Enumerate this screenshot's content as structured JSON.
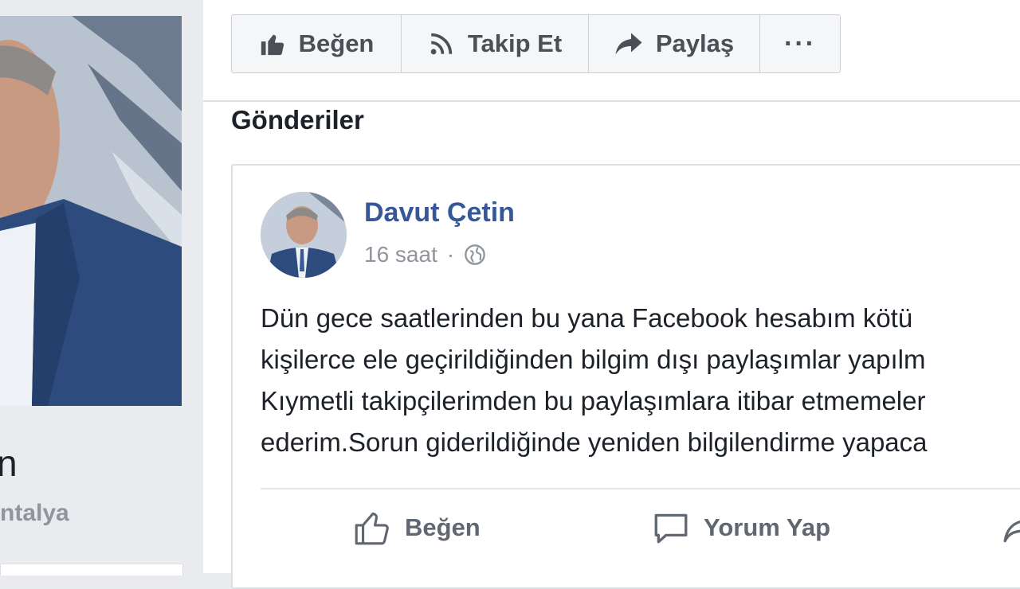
{
  "profile": {
    "name_fragment": "n",
    "location_fragment": "ntalya"
  },
  "action_bar": {
    "like_label": "Beğen",
    "follow_label": "Takip Et",
    "share_label": "Paylaş",
    "more_label": "···"
  },
  "posts_heading": "Gönderiler",
  "post": {
    "author": "Davut Çetin",
    "time": "16 saat",
    "separator": "·",
    "text_lines": [
      "Dün gece saatlerinden bu yana Facebook hesabım kötü",
      "kişilerce ele geçirildiğinden bilgim dışı paylaşımlar yapılm",
      "Kıymetli takipçilerimden bu paylaşımlara itibar etmemeler",
      "ederim.Sorun giderildiğinde yeniden bilgilendirme yapaca"
    ],
    "actions": {
      "like": "Beğen",
      "comment": "Yorum Yap"
    }
  },
  "colors": {
    "link_blue": "#365899",
    "secondary_text": "#90949c",
    "page_bg": "#e9ebee"
  }
}
